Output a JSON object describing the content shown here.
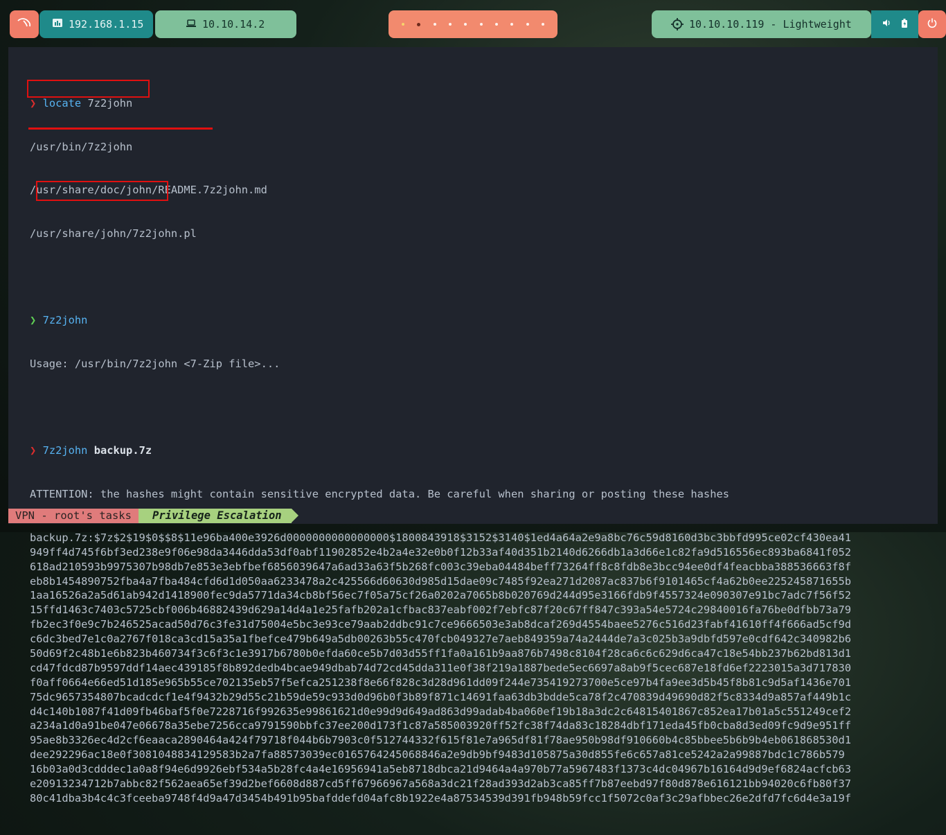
{
  "topbar": {
    "logo_icon": "kali-dragon-icon",
    "lan_ip": "192.168.1.15",
    "vpn_ip": "10.10.14.2",
    "workspaces_count": 10,
    "target": "10.10.10.119 - Lightweight",
    "volume_icon": "volume-icon",
    "battery_icon": "battery-icon",
    "power_icon": "power-icon"
  },
  "terminal": {
    "prompt_symbol": "❯",
    "cmd1": "locate",
    "cmd1_arg": " 7z2john",
    "out1": [
      "/usr/bin/7z2john",
      "/usr/share/doc/john/README.7z2john.md",
      "/usr/share/john/7z2john.pl"
    ],
    "cmd2": "7z2john",
    "out2": "Usage: /usr/bin/7z2john <7-Zip file>...",
    "cmd3": "7z2john",
    "cmd3_arg": "backup.7z",
    "attention": "ATTENTION: the hashes might contain sensitive encrypted data. Be careful when sharing or posting these hashes",
    "hash_lines": [
      "backup.7z:$7z$2$19$0$$8$11e96ba400e3926d0000000000000000$1800843918$3152$3140$1ed4a64a2e9a8bc76c59d8160d3bc3bbfd995ce02cf430ea41",
      "949ff4d745f6bf3ed238e9f06e98da3446dda53df0abf11902852e4b2a4e32e0b0f12b33af40d351b2140d6266db1a3d66e1c82fa9d516556ec893ba6841f052",
      "618ad210593b9975307b98db7e853e3ebfbef6856039647a6ad33a63f5b268fc003c39eba04484beff73264ff8c8fdb8e3bcc94ee0df4feacbba388536663f8f",
      "eb8b1454890752fba4a7fba484cfd6d1d050aa6233478a2c425566d60630d985d15dae09c7485f92ea271d2087ac837b6f9101465cf4a62b0ee225245871655b",
      "1aa16526a2a5d61ab942d1418900fec9da5771da34cb8bf56ec7f05a75cf26a0202a7065b8b020769d244d95e3166fdb9f4557324e090307e91bc7adc7f56f52",
      "15ffd1463c7403c5725cbf006b46882439d629a14d4a1e25fafb202a1cfbac837eabf002f7ebfc87f20c67ff847c393a54e5724c29840016fa76be0dfbb73a79",
      "fb2ec3f0e9c7b246525acad50d76c3fe31d75004e5bc3e93ce79aab2ddbc91c7ce9666503e3ab8dcaf269d4554baee5276c516d23fabf41610ff4f666ad5cf9d",
      "c6dc3bed7e1c0a2767f018ca3cd15a35a1fbefce479b649a5db00263b55c470fcb049327e7aeb849359a74a2444de7a3c025b3a9dbfd597e0cdf642c340982b6",
      "50d69f2c48b1e6b823b460734f3c6f3c1e3917b6780b0efda60ce5b7d03d55ff1fa0a161b9aa876b7498c8104f28ca6c6c629d6ca47c18e54bb237b62bd813d1",
      "cd47fdcd87b9597ddf14aec439185f8b892dedb4bcae949dbab74d72cd45dda311e0f38f219a1887bede5ec6697a8ab9f5cec687e18fd6ef2223015a3d717830",
      "f0aff0664e66ed51d185e965b55ce702135eb57f5efca251238f8e66f828c3d28d961dd09f244e735419273700e5ce97b4fa9ee3d5b45f8b81c9d5af1436e701",
      "75dc9657354807bcadcdcf1e4f9432b29d55c21b59de59c933d0d96b0f3b89f871c14691faa63db3bdde5ca78f2c470839d49690d82f5c8334d9a857af449b1c",
      "d4c140b1087f41d09fb46baf5f0e7228716f992635e99861621d0e99d9d649ad863d99adab4ba060ef19b18a3dc2c64815401867c852ea17b01a5c551249cef2",
      "a234a1d0a91be047e06678a35ebe7256cca9791590bbfc37ee200d173f1c87a585003920ff52fc38f74da83c18284dbf171eda45fb0cba8d3ed09fc9d9e951ff",
      "95ae8b3326ec4d2cf6eaaca2890464a424f79718f044b6b7903c0f512744332f615f81e7a965df81f78ae950b98df910660b4c85bbee5b6b9b4eb061868530d1",
      "dee292296ac18e0f3081048834129583b2a7fa88573039ec0165764245068846a2e9db9bf9483d105875a30d855fe6c657a81ce5242a2a99887bdc1c786b579",
      "16b03a0d3cdddec1a0a8f94e6d9926ebf534a5b28fc4a4e16956941a5eb8718dbca21d9464a4a970b77a5967483f1373c4dc04967b16164d9d9ef6824acfcb63",
      "e20913234712b7abbc82f562aea65ef39d2bef6608d887cd5ff67966967a568a3dc21f28ad393d2ab3ca85ff7b87eebd97f80d878e616121bb94020c6fb80f37",
      "80c41dba3b4c4c3fceeba9748f4d9a47d3454b491b95bafddefd04afc8b1922e4a87534539d391fb948b59fcc1f5072c0af3c29afbbec26e2dfd7fc6d4e3a19f"
    ]
  },
  "statusbar": {
    "session": "VPN - root's tasks",
    "window": "Privilege Escalation"
  }
}
